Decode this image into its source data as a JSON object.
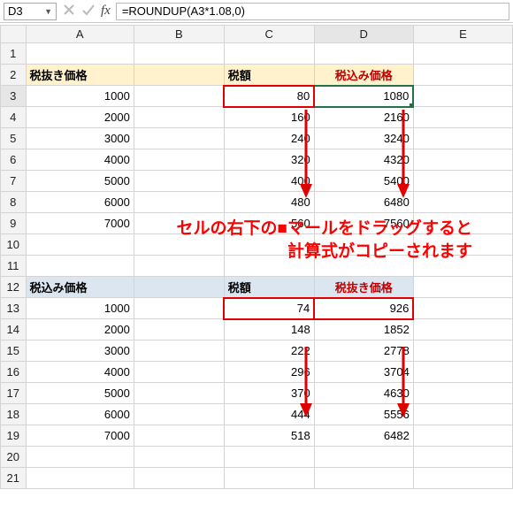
{
  "namebox": {
    "value": "D3"
  },
  "formula": {
    "value": "=ROUNDUP(A3*1.08,0)"
  },
  "columns": [
    "A",
    "B",
    "C",
    "D",
    "E"
  ],
  "rows": [
    "1",
    "2",
    "3",
    "4",
    "5",
    "6",
    "7",
    "8",
    "9",
    "10",
    "11",
    "12",
    "13",
    "14",
    "15",
    "16",
    "17",
    "18",
    "19",
    "20",
    "21"
  ],
  "overlay": {
    "line1": "セルの右下の■マールをドラッグすると",
    "line2": "計算式がコピーされます"
  },
  "section1": {
    "header_a": "税抜き価格",
    "header_c": "税額",
    "header_d": "税込み価格"
  },
  "section2": {
    "header_a": "税込み価格",
    "header_c": "税額",
    "header_d": "税抜き価格"
  },
  "data1": [
    {
      "a": "1000",
      "c": "80",
      "d": "1080"
    },
    {
      "a": "2000",
      "c": "160",
      "d": "2160"
    },
    {
      "a": "3000",
      "c": "240",
      "d": "3240"
    },
    {
      "a": "4000",
      "c": "320",
      "d": "4320"
    },
    {
      "a": "5000",
      "c": "400",
      "d": "5400"
    },
    {
      "a": "6000",
      "c": "480",
      "d": "6480"
    },
    {
      "a": "7000",
      "c": "560",
      "d": "7560"
    }
  ],
  "data2": [
    {
      "a": "1000",
      "c": "74",
      "d": "926"
    },
    {
      "a": "2000",
      "c": "148",
      "d": "1852"
    },
    {
      "a": "3000",
      "c": "222",
      "d": "2778"
    },
    {
      "a": "4000",
      "c": "296",
      "d": "3704"
    },
    {
      "a": "5000",
      "c": "370",
      "d": "4630"
    },
    {
      "a": "6000",
      "c": "444",
      "d": "5556"
    },
    {
      "a": "7000",
      "c": "518",
      "d": "6482"
    }
  ]
}
